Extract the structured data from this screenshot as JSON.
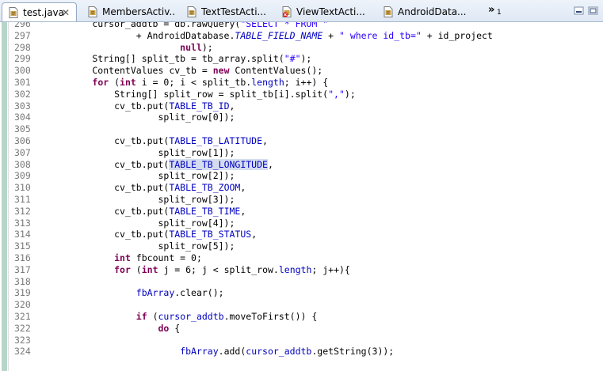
{
  "tabs": [
    {
      "label": "test.java",
      "active": true,
      "icon": "java-file-icon",
      "has_close": true
    },
    {
      "label": "MembersActiv...",
      "active": false,
      "icon": "java-file-icon",
      "has_close": false
    },
    {
      "label": "TextTestActi...",
      "active": false,
      "icon": "java-file-icon",
      "has_close": false
    },
    {
      "label": "ViewTextActi...",
      "active": false,
      "icon": "java-file-error-icon",
      "has_close": false
    },
    {
      "label": "AndroidData...",
      "active": false,
      "icon": "java-file-icon",
      "has_close": false
    }
  ],
  "tab_overflow": {
    "chevron": "»",
    "count": "1"
  },
  "close_glyph": "✕",
  "colors": {
    "keyword": "#7f0055",
    "field": "#0000c0",
    "string": "#2a00ff",
    "line_number": "#787878",
    "change_bar": "#b7d6c7",
    "highlight": "#d4dcf0"
  },
  "lines": [
    {
      "num": "296",
      "tokens": [
        {
          "t": "        cursor_addtb = db.rawQuery(",
          "c": "plain"
        },
        {
          "t": "\"SELECT * FROM \"",
          "c": "string"
        }
      ]
    },
    {
      "num": "297",
      "tokens": [
        {
          "t": "                + AndroidDatabase.",
          "c": "plain"
        },
        {
          "t": "TABLE_FIELD_NAME",
          "c": "static"
        },
        {
          "t": " + ",
          "c": "plain"
        },
        {
          "t": "\" where id_tb=\"",
          "c": "string"
        },
        {
          "t": " + id_project",
          "c": "plain"
        }
      ]
    },
    {
      "num": "298",
      "tokens": [
        {
          "t": "                        ",
          "c": "plain"
        },
        {
          "t": "null",
          "c": "kw"
        },
        {
          "t": ");",
          "c": "plain"
        }
      ]
    },
    {
      "num": "299",
      "tokens": [
        {
          "t": "        String[] split_tb = tb_array.split(",
          "c": "plain"
        },
        {
          "t": "\"#\"",
          "c": "string"
        },
        {
          "t": ");",
          "c": "plain"
        }
      ]
    },
    {
      "num": "300",
      "tokens": [
        {
          "t": "        ContentValues cv_tb = ",
          "c": "plain"
        },
        {
          "t": "new",
          "c": "kw"
        },
        {
          "t": " ContentValues();",
          "c": "plain"
        }
      ]
    },
    {
      "num": "301",
      "tokens": [
        {
          "t": "        ",
          "c": "plain"
        },
        {
          "t": "for",
          "c": "kw"
        },
        {
          "t": " (",
          "c": "plain"
        },
        {
          "t": "int",
          "c": "kw"
        },
        {
          "t": " i = 0; i < split_tb.",
          "c": "plain"
        },
        {
          "t": "length",
          "c": "field"
        },
        {
          "t": "; i++) {",
          "c": "plain"
        }
      ]
    },
    {
      "num": "302",
      "tokens": [
        {
          "t": "            String[] split_row = split_tb[i].split(",
          "c": "plain"
        },
        {
          "t": "\",\"",
          "c": "string"
        },
        {
          "t": ");",
          "c": "plain"
        }
      ]
    },
    {
      "num": "303",
      "tokens": [
        {
          "t": "            cv_tb.put(",
          "c": "plain"
        },
        {
          "t": "TABLE_TB_ID",
          "c": "field"
        },
        {
          "t": ",",
          "c": "plain"
        }
      ]
    },
    {
      "num": "304",
      "tokens": [
        {
          "t": "                    split_row[0]);",
          "c": "plain"
        }
      ]
    },
    {
      "num": "305",
      "tokens": []
    },
    {
      "num": "306",
      "tokens": [
        {
          "t": "            cv_tb.put(",
          "c": "plain"
        },
        {
          "t": "TABLE_TB_LATITUDE",
          "c": "field"
        },
        {
          "t": ",",
          "c": "plain"
        }
      ]
    },
    {
      "num": "307",
      "tokens": [
        {
          "t": "                    split_row[1]);",
          "c": "plain"
        }
      ]
    },
    {
      "num": "308",
      "tokens": [
        {
          "t": "            cv_tb.put(",
          "c": "plain"
        },
        {
          "t": "TABLE_TB_LONGITUDE",
          "c": "field-hl"
        },
        {
          "t": ",",
          "c": "plain"
        }
      ]
    },
    {
      "num": "309",
      "tokens": [
        {
          "t": "                    split_row[2]);",
          "c": "plain"
        }
      ]
    },
    {
      "num": "310",
      "tokens": [
        {
          "t": "            cv_tb.put(",
          "c": "plain"
        },
        {
          "t": "TABLE_TB_ZOOM",
          "c": "field"
        },
        {
          "t": ",",
          "c": "plain"
        }
      ]
    },
    {
      "num": "311",
      "tokens": [
        {
          "t": "                    split_row[3]);",
          "c": "plain"
        }
      ]
    },
    {
      "num": "312",
      "tokens": [
        {
          "t": "            cv_tb.put(",
          "c": "plain"
        },
        {
          "t": "TABLE_TB_TIME",
          "c": "field"
        },
        {
          "t": ",",
          "c": "plain"
        }
      ]
    },
    {
      "num": "313",
      "tokens": [
        {
          "t": "                    split_row[4]);",
          "c": "plain"
        }
      ]
    },
    {
      "num": "314",
      "tokens": [
        {
          "t": "            cv_tb.put(",
          "c": "plain"
        },
        {
          "t": "TABLE_TB_STATUS",
          "c": "field"
        },
        {
          "t": ",",
          "c": "plain"
        }
      ]
    },
    {
      "num": "315",
      "tokens": [
        {
          "t": "                    split_row[5]);",
          "c": "plain"
        }
      ]
    },
    {
      "num": "316",
      "tokens": [
        {
          "t": "            ",
          "c": "plain"
        },
        {
          "t": "int",
          "c": "kw"
        },
        {
          "t": " fbcount = 0;",
          "c": "plain"
        }
      ]
    },
    {
      "num": "317",
      "tokens": [
        {
          "t": "            ",
          "c": "plain"
        },
        {
          "t": "for",
          "c": "kw"
        },
        {
          "t": " (",
          "c": "plain"
        },
        {
          "t": "int",
          "c": "kw"
        },
        {
          "t": " j = 6; j < split_row.",
          "c": "plain"
        },
        {
          "t": "length",
          "c": "field"
        },
        {
          "t": "; j++){",
          "c": "plain"
        }
      ]
    },
    {
      "num": "318",
      "tokens": []
    },
    {
      "num": "319",
      "tokens": [
        {
          "t": "                ",
          "c": "plain"
        },
        {
          "t": "fbArray",
          "c": "field"
        },
        {
          "t": ".clear();",
          "c": "plain"
        }
      ]
    },
    {
      "num": "320",
      "tokens": []
    },
    {
      "num": "321",
      "tokens": [
        {
          "t": "                ",
          "c": "plain"
        },
        {
          "t": "if",
          "c": "kw"
        },
        {
          "t": " (",
          "c": "plain"
        },
        {
          "t": "cursor_addtb",
          "c": "field"
        },
        {
          "t": ".moveToFirst()) {",
          "c": "plain"
        }
      ]
    },
    {
      "num": "322",
      "tokens": [
        {
          "t": "                    ",
          "c": "plain"
        },
        {
          "t": "do",
          "c": "kw"
        },
        {
          "t": " {",
          "c": "plain"
        }
      ]
    },
    {
      "num": "323",
      "tokens": []
    },
    {
      "num": "324",
      "tokens": [
        {
          "t": "                        ",
          "c": "plain"
        },
        {
          "t": "fbArray",
          "c": "field"
        },
        {
          "t": ".add(",
          "c": "plain"
        },
        {
          "t": "cursor_addtb",
          "c": "field"
        },
        {
          "t": ".getString(3));",
          "c": "plain"
        }
      ]
    }
  ]
}
